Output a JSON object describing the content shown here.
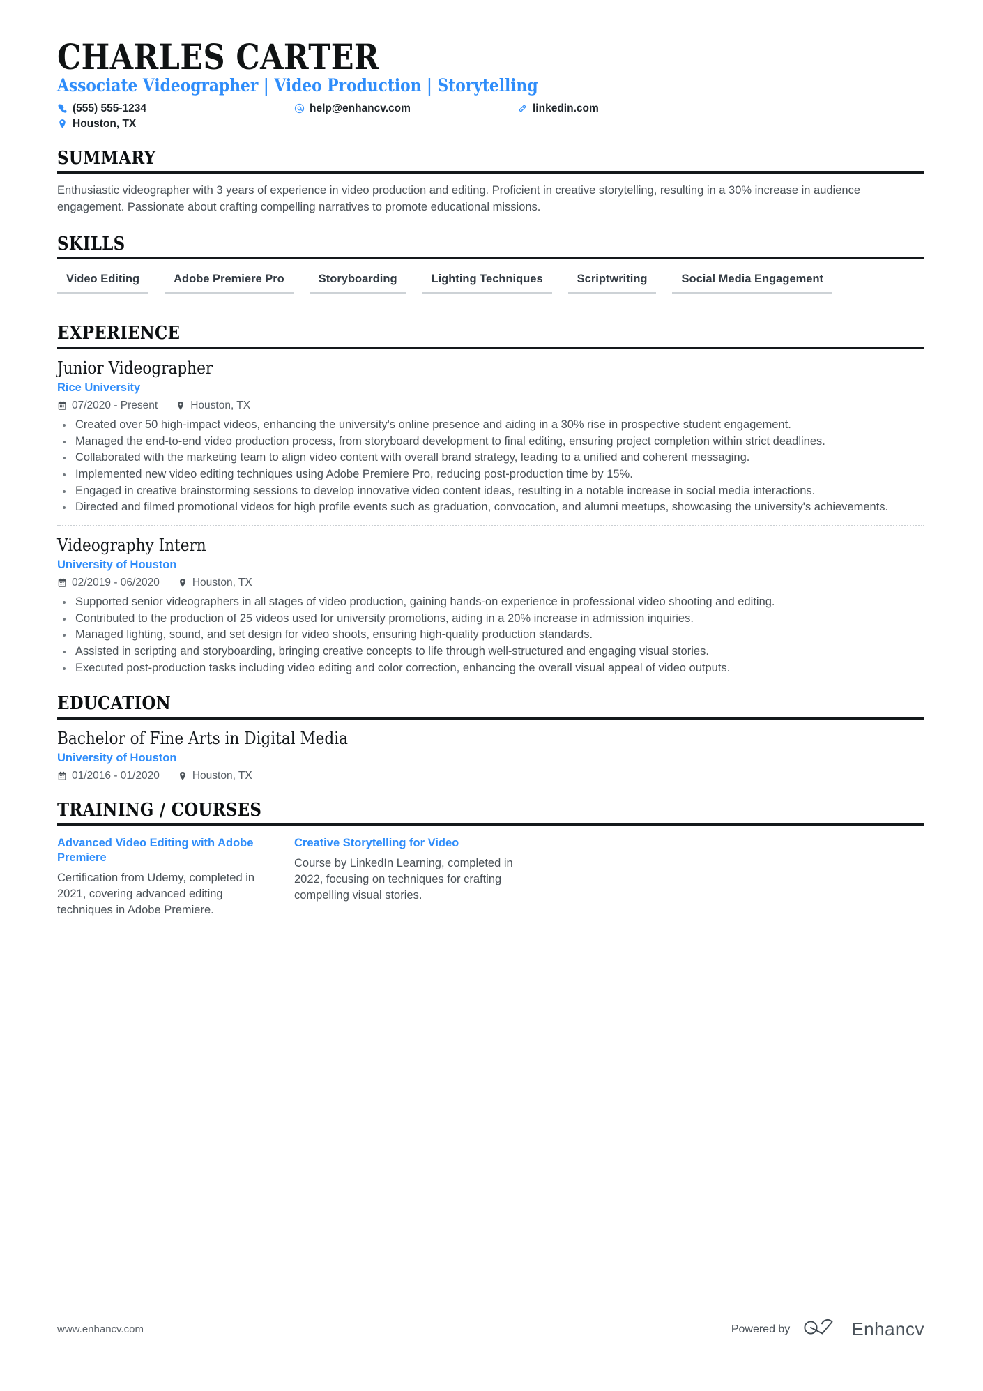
{
  "header": {
    "name": "CHARLES CARTER",
    "headline": "Associate Videographer | Video Production | Storytelling",
    "contacts": {
      "phone": "(555) 555-1234",
      "email": "help@enhancv.com",
      "linkedin": "linkedin.com",
      "location": "Houston, TX"
    }
  },
  "colors": {
    "accent_blue": "#2f8dfa",
    "rule_black": "#14181b",
    "body_gray": "#4a5157",
    "skill_underline": "#cdd2d6"
  },
  "sections": {
    "summary": {
      "title": "SUMMARY",
      "text": "Enthusiastic videographer with 3 years of experience in video production and editing. Proficient in creative storytelling, resulting in a 30% increase in audience engagement. Passionate about crafting compelling narratives to promote educational missions."
    },
    "skills": {
      "title": "SKILLS",
      "items": [
        "Video Editing",
        "Adobe Premiere Pro",
        "Storyboarding",
        "Lighting Techniques",
        "Scriptwriting",
        "Social Media Engagement"
      ]
    },
    "experience": {
      "title": "EXPERIENCE",
      "entries": [
        {
          "title": "Junior Videographer",
          "org": "Rice University",
          "dates": "07/2020 - Present",
          "location": "Houston, TX",
          "bullets": [
            "Created over 50 high-impact videos, enhancing the university's online presence and aiding in a 30% rise in prospective student engagement.",
            "Managed the end-to-end video production process, from storyboard development to final editing, ensuring project completion within strict deadlines.",
            "Collaborated with the marketing team to align video content with overall brand strategy, leading to a unified and coherent messaging.",
            "Implemented new video editing techniques using Adobe Premiere Pro, reducing post-production time by 15%.",
            "Engaged in creative brainstorming sessions to develop innovative video content ideas, resulting in a notable increase in social media interactions.",
            "Directed and filmed promotional videos for high profile events such as graduation, convocation, and alumni meetups, showcasing the university's achievements."
          ]
        },
        {
          "title": "Videography Intern",
          "org": "University of Houston",
          "dates": "02/2019 - 06/2020",
          "location": "Houston, TX",
          "bullets": [
            "Supported senior videographers in all stages of video production, gaining hands-on experience in professional video shooting and editing.",
            "Contributed to the production of 25 videos used for university promotions, aiding in a 20% increase in admission inquiries.",
            "Managed lighting, sound, and set design for video shoots, ensuring high-quality production standards.",
            "Assisted in scripting and storyboarding, bringing creative concepts to life through well-structured and engaging visual stories.",
            "Executed post-production tasks including video editing and color correction, enhancing the overall visual appeal of video outputs."
          ]
        }
      ]
    },
    "education": {
      "title": "EDUCATION",
      "entries": [
        {
          "title": "Bachelor of Fine Arts in Digital Media",
          "org": "University of Houston",
          "dates": "01/2016 - 01/2020",
          "location": "Houston, TX"
        }
      ]
    },
    "courses": {
      "title": "TRAINING / COURSES",
      "items": [
        {
          "title": "Advanced Video Editing with Adobe Premiere",
          "desc": "Certification from Udemy, completed in 2021, covering advanced editing techniques in Adobe Premiere."
        },
        {
          "title": "Creative Storytelling for Video",
          "desc": "Course by LinkedIn Learning, completed in 2022, focusing on techniques for crafting compelling visual stories."
        }
      ]
    }
  },
  "footer": {
    "url": "www.enhancv.com",
    "powered_by": "Powered by",
    "brand": "Enhancv"
  }
}
